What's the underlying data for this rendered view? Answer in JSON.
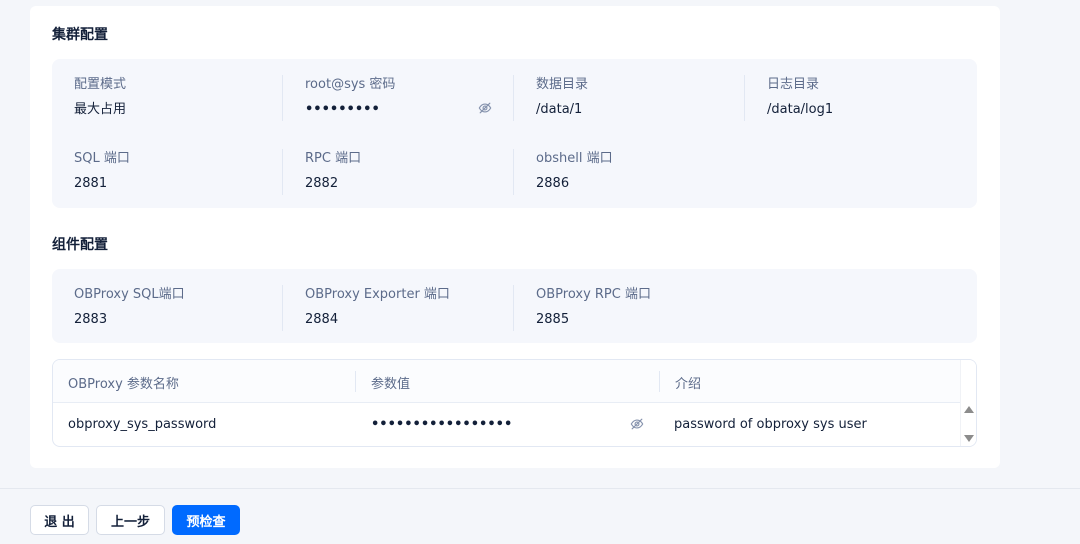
{
  "cluster_section": {
    "title": "集群配置",
    "fields": {
      "config_mode": {
        "label": "配置模式",
        "value": "最大占用"
      },
      "root_password": {
        "label": "root@sys 密码",
        "value": "•••••••••",
        "icon": "eye-invisible-icon"
      },
      "data_dir": {
        "label": "数据目录",
        "value": "/data/1"
      },
      "log_dir": {
        "label": "日志目录",
        "value": "/data/log1"
      },
      "sql_port": {
        "label": "SQL 端口",
        "value": "2881"
      },
      "rpc_port": {
        "label": "RPC 端口",
        "value": "2882"
      },
      "obshell_port": {
        "label": "obshell 端口",
        "value": "2886"
      }
    }
  },
  "component_section": {
    "title": "组件配置",
    "fields": {
      "obproxy_sql_port": {
        "label": "OBProxy SQL端口",
        "value": "2883"
      },
      "obproxy_exporter_port": {
        "label": "OBProxy Exporter 端口",
        "value": "2884"
      },
      "obproxy_rpc_port": {
        "label": "OBProxy RPC 端口",
        "value": "2885"
      }
    },
    "table": {
      "headers": {
        "name": "OBProxy 参数名称",
        "value": "参数值",
        "desc": "介绍"
      },
      "rows": [
        {
          "name": "obproxy_sys_password",
          "value": "•••••••••••••••••",
          "desc": "password of obproxy sys user",
          "icon": "eye-invisible-icon"
        }
      ]
    }
  },
  "footer": {
    "exit_label": "退 出",
    "prev_label": "上一步",
    "precheck_label": "预检查"
  },
  "colors": {
    "primary": "#006aff",
    "info_bg": "#f5f7fc",
    "label": "#5c6b8a",
    "text": "#132039"
  }
}
